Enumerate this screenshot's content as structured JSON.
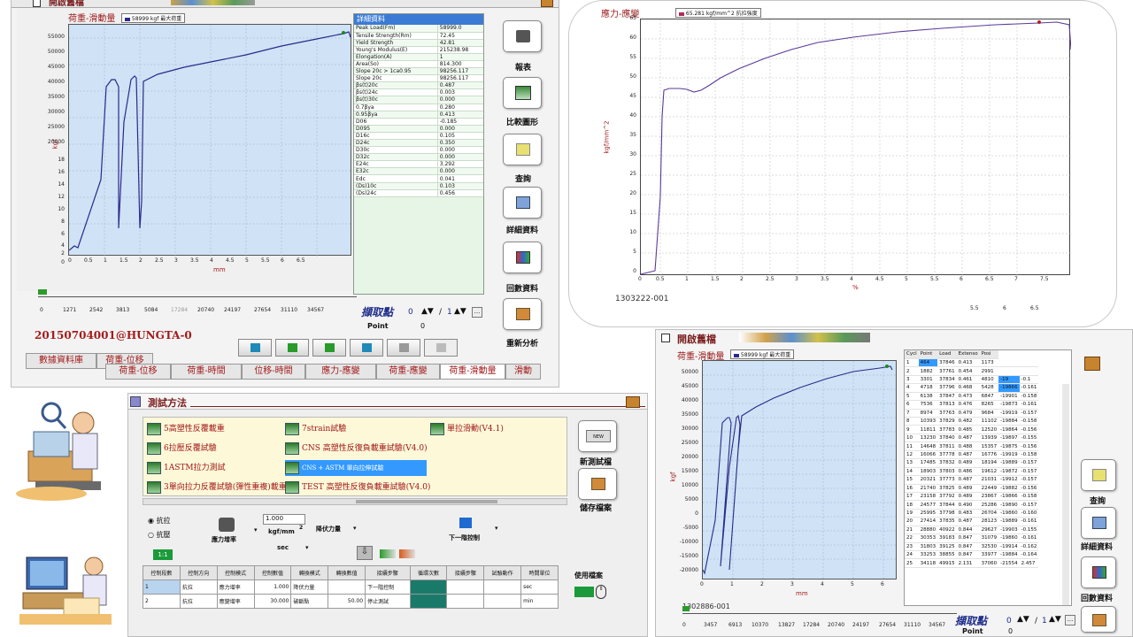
{
  "top_window": {
    "title": "開啟舊檔",
    "chart_title": "荷重-滑動量",
    "legend": "58999 kgf 最大荷重",
    "y_label": "kgf",
    "x_label": "mm",
    "y_ticks": [
      "55000",
      "50000",
      "45000",
      "40000",
      "35000",
      "30000",
      "25000",
      "20000",
      "18",
      "16",
      "14",
      "12",
      "10",
      "8",
      "6",
      "4",
      "2",
      "0"
    ],
    "x_ticks": [
      "0",
      "0.5",
      "1",
      "1.5",
      "2",
      "2.5",
      "3",
      "3.5",
      "4",
      "4.5",
      "5",
      "5.5",
      "6",
      "6.5"
    ],
    "detail_title": "詳細資料",
    "detail_rows": [
      [
        "Peak Load(Fm)",
        "58999.0"
      ],
      [
        "Tensile Strength(Rm)",
        "72.45"
      ],
      [
        "Yield Strength",
        "42.81"
      ],
      [
        "Young's Modulus(E)",
        "215238.98"
      ],
      [
        "Elongation(A)",
        "1"
      ],
      [
        "Area(So)",
        "814.300"
      ],
      [
        "Slope 20c > 1ca0.95",
        "98256.117"
      ],
      [
        "Slope 20c",
        "98256.117"
      ],
      [
        "βs(t)20c",
        "0.487"
      ],
      [
        "βs(t)24c",
        "0.003"
      ],
      [
        "βs(t)30c",
        "0.000"
      ],
      [
        "0.7βya",
        "0.280"
      ],
      [
        "0.95βya",
        "0.413"
      ],
      [
        "D06",
        "-0.185"
      ],
      [
        "D095",
        "0.000"
      ],
      [
        "D16c",
        "0.105"
      ],
      [
        "D24c",
        "0.350"
      ],
      [
        "D30c",
        "0.000"
      ],
      [
        "D32c",
        "0.000"
      ],
      [
        "E24c",
        "3.292"
      ],
      [
        "E32c",
        "0.000"
      ],
      [
        "Edc",
        "0.041"
      ],
      [
        "(Ds)10c",
        "0.103"
      ],
      [
        "(Ds)24c",
        "0.456"
      ]
    ],
    "slider_ticks": [
      "0",
      "1271",
      "2542",
      "3813",
      "5084",
      "17284",
      "20740",
      "24197",
      "27654",
      "31110",
      "34567"
    ],
    "capture_label": "擷取點",
    "capture_value": "0",
    "capture_slash": "/",
    "capture_total": "1",
    "point_label": "Point",
    "point_value": "0",
    "file_id": "20150704001@HUNGTA-0",
    "bottom_tabs": [
      "數據資料庫",
      "荷重-位移"
    ],
    "chart_tabs": [
      "荷重-位移",
      "荷重-時間",
      "位移-時間",
      "應力-應變",
      "荷重-應變",
      "荷重-滑動量",
      "滑動"
    ],
    "active_tab": "荷重-滑動量",
    "side_buttons": [
      "報表",
      "比較圖形",
      "查詢",
      "詳細資料",
      "回數資料",
      "重新分析"
    ]
  },
  "stress_chart": {
    "title": "應力-應變",
    "legend": "65.281 kgf/mm^2 抗拉強度",
    "y_label": "kgf/mm^2",
    "x_label": "%",
    "y_ticks": [
      "65",
      "60",
      "55",
      "50",
      "45",
      "40",
      "35",
      "30",
      "25",
      "20",
      "15",
      "10",
      "5",
      "0"
    ],
    "x_ticks": [
      "0",
      "0.5",
      "1",
      "1.5",
      "2",
      "2.5",
      "3",
      "3.5",
      "4",
      "4.5",
      "5",
      "5.5",
      "6",
      "6.5",
      "7",
      "7.5"
    ],
    "extra_ticks": [
      "5.5",
      "6",
      "6.5"
    ],
    "sample_id": "1303222-001"
  },
  "method_window": {
    "title": "測試方法",
    "methods": [
      "5高塑性反覆載重",
      "6拉壓反覆試驗",
      "1ASTM拉力測試",
      "3單向拉力反覆試驗(彈性重複)載重",
      "7strain試驗",
      "CNS 高塑性反復負載重試驗(V4.0)",
      "CNS + ASTM 單向拉伸試驗",
      "TEST 高塑性反復負載重試驗(V4.0)",
      "單拉滑動(V4.1)"
    ],
    "selected_method": "CNS + ASTM 單向拉伸試驗",
    "new_label": "新測試檔",
    "new_btn_text": "NEW",
    "save_label": "儲存檔案",
    "radio_1": "抗拉",
    "radio_2": "抗壓",
    "stress_rate_label": "應力增率",
    "rate_value": "1.000",
    "rate_unit_1": "kgf/mm",
    "rate_unit_sup": "2",
    "rate_unit_2": "sec",
    "load_mode": "降伏力量",
    "next_control": "下一階控制",
    "badge_text": "1:1",
    "grid_headers": [
      "控制段數",
      "控制方向",
      "控制模式",
      "控制數值",
      "轉換模式",
      "轉換數值",
      "接續步驟",
      "循環次數",
      "接續步驟",
      "試驗動作",
      "時間單位"
    ],
    "grid_rows": [
      [
        "1",
        "抗拉",
        "應力增率",
        "1.000",
        "降伏力量",
        "",
        "下一階控制",
        "",
        "",
        "",
        "sec"
      ],
      [
        "2",
        "抗拉",
        "應變增率",
        "30.000",
        "破斷點",
        "50.00",
        "停止測試",
        "",
        "",
        "",
        "min"
      ]
    ],
    "use_file_label": "使用檔案"
  },
  "bottom_window": {
    "title": "開啟舊檔",
    "chart_title": "荷重-滑動量",
    "legend": "58999 kgf 最大荷重",
    "y_label": "kgf",
    "x_label": "mm",
    "y_ticks": [
      "50000",
      "45000",
      "40000",
      "35000",
      "30000",
      "25000",
      "20000",
      "15000",
      "10000",
      "5000",
      "0",
      "-5000",
      "-10000",
      "-15000",
      "-20000"
    ],
    "x_ticks": [
      "0",
      "1",
      "2",
      "3",
      "4",
      "5",
      "6"
    ],
    "sample_id": "1302886-001",
    "table_headers": [
      "Cycl",
      "Point",
      "Load",
      "Extenso",
      "Posi"
    ],
    "table_rows": [
      [
        "1",
        "464",
        "37846",
        "0.413",
        "1173",
        ""
      ],
      [
        "2",
        "1882",
        "37761",
        "0.454",
        "2991",
        ""
      ],
      [
        "3",
        "3301",
        "37834",
        "0.461",
        "4810",
        "-19"
      ],
      [
        "4",
        "4718",
        "37796",
        "0.468",
        "5428",
        "-19866"
      ],
      [
        "5",
        "6138",
        "37847",
        "0.473",
        "6847",
        "-19901"
      ],
      [
        "6",
        "7536",
        "37813",
        "0.476",
        "8265",
        "-19873"
      ],
      [
        "7",
        "8974",
        "37763",
        "0.479",
        "9684",
        "-19919"
      ],
      [
        "8",
        "10393",
        "37829",
        "0.482",
        "11102",
        "-19884"
      ],
      [
        "9",
        "11811",
        "37783",
        "0.485",
        "12520",
        "-19864"
      ],
      [
        "10",
        "13230",
        "37840",
        "0.487",
        "13939",
        "-19897"
      ],
      [
        "11",
        "14648",
        "37811",
        "0.488",
        "15357",
        "-19875"
      ],
      [
        "12",
        "16066",
        "37778",
        "0.487",
        "16776",
        "-19919"
      ],
      [
        "13",
        "17485",
        "37832",
        "0.489",
        "18194",
        "-19889"
      ],
      [
        "14",
        "18903",
        "37803",
        "0.486",
        "19612",
        "-19872"
      ],
      [
        "15",
        "20321",
        "37773",
        "0.487",
        "21031",
        "-19912"
      ],
      [
        "16",
        "21740",
        "37825",
        "0.489",
        "22449",
        "-19882"
      ],
      [
        "17",
        "23158",
        "37792",
        "0.489",
        "23867",
        "-19866"
      ],
      [
        "18",
        "24577",
        "37844",
        "0.490",
        "25286",
        "-19890"
      ],
      [
        "19",
        "25995",
        "37798",
        "0.483",
        "26704",
        "-19860"
      ],
      [
        "20",
        "27414",
        "37835",
        "0.487",
        "28123",
        "-19889"
      ],
      [
        "21",
        "28880",
        "40922",
        "0.844",
        "29627",
        "-19903"
      ],
      [
        "22",
        "30353",
        "39183",
        "0.847",
        "31079",
        "-19860"
      ],
      [
        "23",
        "31803",
        "39125",
        "0.847",
        "32530",
        "-19914"
      ],
      [
        "24",
        "33253",
        "38855",
        "0.847",
        "33977",
        "-19884"
      ],
      [
        "25",
        "34118",
        "49915",
        "2.131",
        "37060",
        "-21554"
      ]
    ],
    "table_tail": [
      "-0.1",
      "-0.161",
      "-0.158",
      "-0.161",
      "-0.157",
      "-0.158",
      "-0.156",
      "-0.155",
      "-0.156",
      "-0.158",
      "-0.157",
      "-0.157",
      "-0.157",
      "-0.156",
      "-0.158",
      "-0.157",
      "-0.160",
      "-0.161",
      "-0.155",
      "-0.161",
      "-0.162",
      "-0.164",
      "2.457"
    ],
    "slider_ticks": [
      "0",
      "3457",
      "6913",
      "10370",
      "13827",
      "17284",
      "20740",
      "24197",
      "27654",
      "31110",
      "34567"
    ],
    "capture_label": "擷取點",
    "capture_value": "0",
    "capture_slash": "/",
    "capture_total": "1",
    "point_label": "Point",
    "point_value": "0",
    "side_buttons": [
      "查詢",
      "詳細資料",
      "回數資料"
    ]
  },
  "colors": {
    "plot_bg": "#cfe2f6",
    "curve": "#2a2a8a",
    "title_red": "#9b1c1c",
    "selected_blue": "#3399ff",
    "teal": "#1a7a6a"
  }
}
